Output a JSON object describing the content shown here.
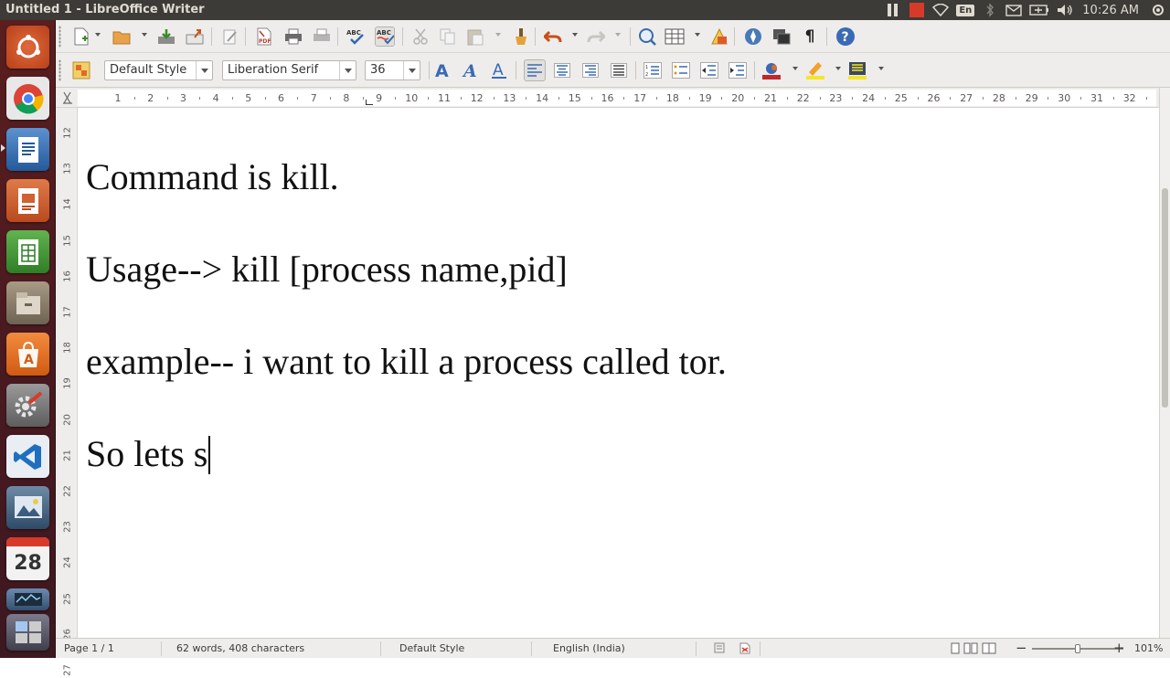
{
  "window": {
    "title": "Untitled 1 - LibreOffice Writer"
  },
  "panel": {
    "language": "En",
    "clock": "10:26 AM"
  },
  "launcher": {
    "items": [
      {
        "name": "ubuntu-dash-icon",
        "color": "#c84f20"
      },
      {
        "name": "chrome-icon",
        "color": "#3e6d9e"
      },
      {
        "name": "writer-icon",
        "color": "#2d6bb0"
      },
      {
        "name": "impress-icon",
        "color": "#c8562c"
      },
      {
        "name": "calc-icon",
        "color": "#3f8f34"
      },
      {
        "name": "files-icon",
        "color": "#8a7f6d"
      },
      {
        "name": "software-center-icon",
        "color": "#e0691f"
      },
      {
        "name": "system-settings-icon",
        "color": "#7f7f7f"
      },
      {
        "name": "vscode-icon",
        "color": "#1f6fc1"
      },
      {
        "name": "image-viewer-icon",
        "color": "#3d5c7a"
      },
      {
        "name": "calendar-icon",
        "color": "#efefef"
      },
      {
        "name": "system-monitor-icon",
        "color": "#4a6a8c"
      },
      {
        "name": "workspace-switcher-icon",
        "color": "#5c5c6a"
      }
    ],
    "calendar_day": "28"
  },
  "formatting": {
    "paragraph_style": "Default Style",
    "font_name": "Liberation Serif",
    "font_size": "36"
  },
  "ruler": {
    "labels": [
      "1",
      "2",
      "3",
      "4",
      "5",
      "6",
      "7",
      "8",
      "9",
      "10",
      "11",
      "12",
      "13",
      "14",
      "15",
      "16",
      "17",
      "18",
      "19",
      "20",
      "21",
      "22",
      "23",
      "24",
      "25",
      "26",
      "27",
      "28",
      "29",
      "30",
      "31",
      "32"
    ],
    "vertical_labels": [
      "12",
      "13",
      "14",
      "15",
      "16",
      "17",
      "18",
      "19",
      "20",
      "21",
      "22",
      "23",
      "24",
      "25",
      "26",
      "27"
    ]
  },
  "document": {
    "lines": [
      "Command is kill.",
      "Usage--> kill [process name,pid]",
      "example-- i want to kill a process called tor.",
      "So lets s"
    ]
  },
  "status": {
    "page": "Page 1 / 1",
    "word_count": "62 words, 408 characters",
    "page_style": "Default Style",
    "language": "English (India)",
    "zoom_percent": "101%",
    "zoom_fraction": 0.5
  },
  "colors": {
    "panel": "#3c3b37",
    "toolbar": "#eeedeb",
    "launcher": "#4a1a20"
  }
}
